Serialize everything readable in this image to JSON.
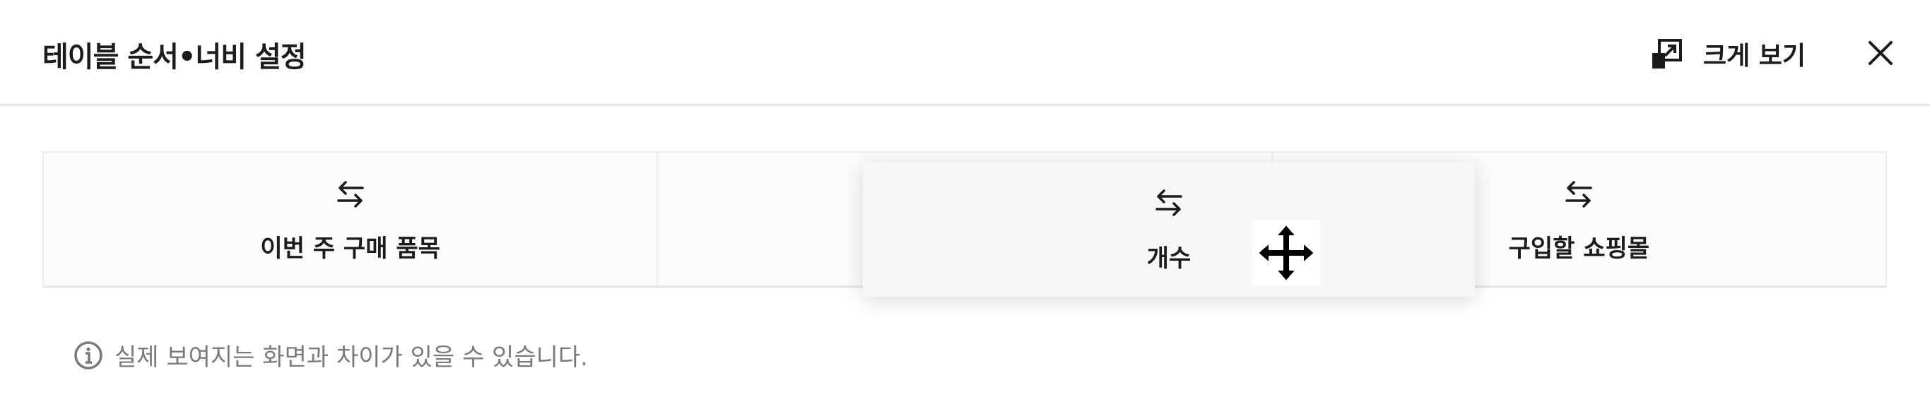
{
  "header": {
    "title": "테이블 순서•너비 설정",
    "expand_label": "크게 보기"
  },
  "columns": [
    {
      "label": "이번 주 구매 품목",
      "icon": "swap-arrows-icon"
    },
    {
      "label": "개수",
      "icon": "swap-arrows-icon",
      "state": "placeholder-while-dragging"
    },
    {
      "label": "구입할 쇼핑몰",
      "icon": "swap-arrows-icon"
    }
  ],
  "dragging": {
    "label": "개수",
    "cursor": "move-cursor-icon"
  },
  "notice": {
    "text": "실제 보여지는 화면과 차이가 있을 수 있습니다.",
    "icon": "info-icon"
  },
  "colors": {
    "text": "#1c1c1c",
    "muted": "#7a7a7a",
    "ghost_text": "#e2e2e2",
    "row_bg": "#fbfbfb",
    "border": "#ececec"
  }
}
